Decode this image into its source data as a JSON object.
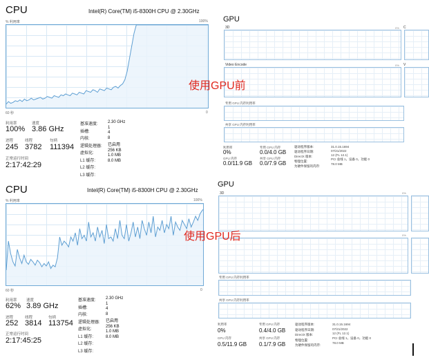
{
  "colors": {
    "graph_line": "#5d9ed2",
    "graph_fill": "#eaf3fb",
    "graph_border": "#6fa9d6",
    "annotation": "#e0281e"
  },
  "before": {
    "annotation": "使用GPU前",
    "cpu": {
      "title": "CPU",
      "model": "Intel(R) Core(TM) i5-8300H CPU @ 2.30GHz",
      "axis_top_left": "% 利用率",
      "axis_top_right": "100%",
      "axis_bottom_left": "60 秒",
      "axis_bottom_right": "0",
      "utilization_series": [
        6,
        9,
        7,
        8,
        10,
        9,
        11,
        9,
        12,
        10,
        11,
        13,
        11,
        12,
        13,
        14,
        12,
        13,
        15,
        14,
        13,
        16,
        15,
        14,
        17,
        16,
        18,
        17,
        16,
        19,
        18,
        17,
        20,
        19,
        18,
        22,
        21,
        20,
        23,
        22,
        20,
        24,
        23,
        22,
        25,
        24,
        23,
        26,
        27,
        25,
        28,
        30,
        35,
        45,
        60,
        75,
        90,
        100,
        100,
        100,
        100,
        100,
        100,
        100,
        100,
        100,
        100,
        100,
        100,
        100,
        100,
        100,
        100,
        100,
        100,
        100,
        100,
        100,
        100,
        100,
        100,
        100,
        100,
        100,
        100,
        100,
        100,
        100,
        100,
        100
      ],
      "stats": {
        "utilization_label": "利用率",
        "utilization_value": "100%",
        "speed_label": "速度",
        "speed_value": "3.86 GHz",
        "processes_label": "进程",
        "processes_value": "245",
        "threads_label": "线程",
        "threads_value": "3782",
        "handles_label": "句柄",
        "handles_value": "111394",
        "uptime_label": "正常运行时间",
        "uptime_value": "2:17:42:29"
      },
      "specs": [
        {
          "label": "基准速度:",
          "value": "2.30 GHz"
        },
        {
          "label": "插槽:",
          "value": "1"
        },
        {
          "label": "内核:",
          "value": "4"
        },
        {
          "label": "逻辑处理器:",
          "value": "8"
        },
        {
          "label": "虚拟化:",
          "value": "已启用"
        },
        {
          "label": "L1 缓存:",
          "value": "256 KB"
        },
        {
          "label": "L2 缓存:",
          "value": "1.0 MB"
        },
        {
          "label": "L3 缓存:",
          "value": "8.0 MB"
        }
      ]
    },
    "gpu": {
      "title": "GPU",
      "pane_3d": "3D",
      "pane_3d_pct": "0%",
      "pane_copy": "C",
      "pane_video_encode": "Video Encode",
      "pane_video_pct": "0%",
      "pane_video_right": "V",
      "dedicated_mem_label": "专用 GPU 内存利用率",
      "shared_mem_label": "共享 GPU 内存利用率",
      "stats": {
        "utilization_label": "利用率",
        "utilization_value": "0%",
        "dedicated_label": "专用 GPU 内存",
        "dedicated_value": "0.0/4.0 GB",
        "gpu_mem_label": "GPU 内存",
        "gpu_mem_value": "0.0/11.9 GB",
        "shared_label": "共享 GPU 内存",
        "shared_value": "0.0/7.9 GB"
      },
      "specs": [
        {
          "label": "驱动程序版本:",
          "value": "31.0.15.1694"
        },
        {
          "label": "驱动程序日期:",
          "value": "07/21/2022"
        },
        {
          "label": "DirectX 版本:",
          "value": "12 (FL 12.1)"
        },
        {
          "label": "物理位置:",
          "value": "PCI 总线 1，设备 0，功能 0"
        },
        {
          "label": "为硬件保留的内存:",
          "value": "78.0 MB"
        }
      ]
    }
  },
  "after": {
    "annotation": "使用GPU后",
    "cpu": {
      "title": "CPU",
      "model": "Intel(R) Core(TM) i5-8300H CPU @ 2.30GHz",
      "axis_top_left": "% 利用率",
      "axis_top_right": "100%",
      "axis_bottom_left": "60 秒",
      "axis_bottom_right": "0",
      "utilization_series": [
        20,
        55,
        40,
        30,
        25,
        45,
        35,
        28,
        38,
        30,
        27,
        33,
        30,
        26,
        32,
        29,
        24,
        28,
        25,
        30,
        22,
        26,
        24,
        35,
        60,
        50,
        55,
        52,
        48,
        60,
        55,
        65,
        50,
        70,
        58,
        62,
        55,
        78,
        60,
        65,
        55,
        72,
        60,
        68,
        52,
        75,
        58,
        60,
        55,
        70,
        58,
        80,
        62,
        58,
        75,
        55,
        65,
        78,
        60,
        72,
        58,
        80,
        70,
        62,
        78,
        65,
        85,
        60,
        72,
        68,
        80,
        65,
        75,
        70,
        85,
        62,
        78,
        72,
        68,
        80,
        75,
        70,
        82,
        72,
        78,
        85,
        80,
        88,
        92,
        95
      ],
      "stats": {
        "utilization_label": "利用率",
        "utilization_value": "62%",
        "speed_label": "速度",
        "speed_value": "3.89 GHz",
        "processes_label": "进程",
        "processes_value": "252",
        "threads_label": "线程",
        "threads_value": "3814",
        "handles_label": "句柄",
        "handles_value": "113754",
        "uptime_label": "正常运行时间",
        "uptime_value": "2:17:45:25"
      },
      "specs": [
        {
          "label": "基准速度:",
          "value": "2.30 GHz"
        },
        {
          "label": "插槽:",
          "value": "1"
        },
        {
          "label": "内核:",
          "value": "4"
        },
        {
          "label": "逻辑处理器:",
          "value": "8"
        },
        {
          "label": "虚拟化:",
          "value": "已启用"
        },
        {
          "label": "L1 缓存:",
          "value": "256 KB"
        },
        {
          "label": "L2 缓存:",
          "value": "1.0 MB"
        },
        {
          "label": "L3 缓存:",
          "value": "8.0 MB"
        }
      ]
    },
    "gpu": {
      "title": "GPU",
      "pane_3d": "3D",
      "pane_3d_pct": "0%",
      "pane_video_pct": "0%",
      "dedicated_mem_label": "专用 GPU 内存利用率",
      "shared_mem_label": "共享 GPU 内存利用率",
      "stats": {
        "utilization_label": "利用率",
        "utilization_value": "0%",
        "dedicated_label": "专用 GPU 内存",
        "dedicated_value": "0.4/4.0 GB",
        "gpu_mem_label": "GPU 内存",
        "gpu_mem_value": "0.5/11.9 GB",
        "shared_label": "共享 GPU 内存",
        "shared_value": "0.1/7.9 GB"
      },
      "specs": [
        {
          "label": "驱动程序版本:",
          "value": "31.0.15.1694"
        },
        {
          "label": "驱动程序日期:",
          "value": "07/21/2022"
        },
        {
          "label": "DirectX 版本:",
          "value": "12 (FL 12.1)"
        },
        {
          "label": "物理位置:",
          "value": "PCI 总线 1，设备 0，功能 0"
        },
        {
          "label": "为硬件保留的内存:",
          "value": "78.0 MB"
        }
      ]
    }
  }
}
